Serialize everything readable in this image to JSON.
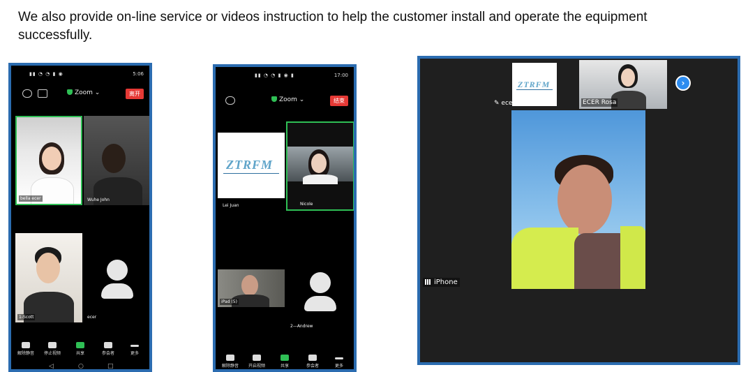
{
  "caption": "We also provide on-line service or videos instruction to help the customer install and operate the equipment successfully.",
  "phone1": {
    "status_time": "5:06",
    "app_name": "Zoom ⌄",
    "leave_label": "离开",
    "participants": [
      "bella ecer",
      "Wuhe John",
      "1-Scott",
      "ecer"
    ],
    "toolbar": [
      "解除静音",
      "停止视频",
      "共享",
      "参会者",
      "更多"
    ],
    "nav": [
      "◁",
      "○",
      "□"
    ]
  },
  "phone2": {
    "status_time": "17:00",
    "app_name": "Zoom ⌄",
    "end_label": "结束",
    "participants": [
      "Lei Juan",
      "Nicole",
      "iPad (5)",
      "2—Andrew"
    ],
    "toolbar": [
      "解除静音",
      "开启视频",
      "共享",
      "参会者",
      "更多"
    ]
  },
  "logo_text": "ZTRFM",
  "panel": {
    "participants": [
      "ecer",
      "ECER Rosa"
    ],
    "main_label": "iPhone",
    "next_label": "›"
  },
  "colors": {
    "frame": "#2b6cb0",
    "accent_green": "#2fbf55",
    "leave_red": "#e53935",
    "chevron_blue": "#2d8cf0"
  }
}
